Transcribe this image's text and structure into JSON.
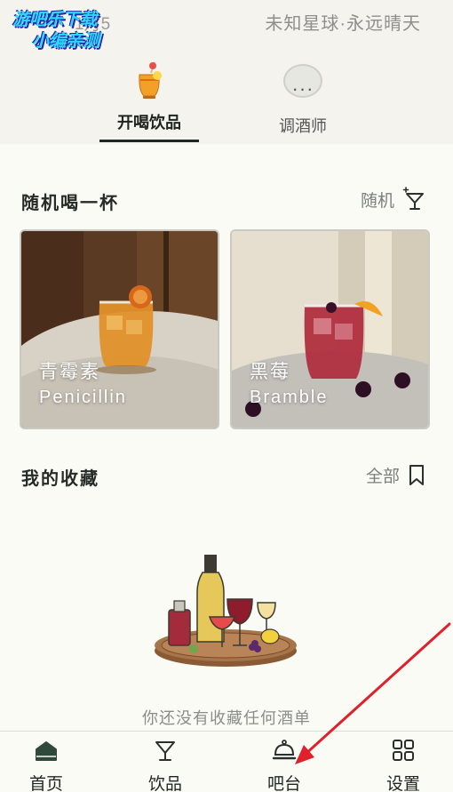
{
  "header": {
    "watermark_line1": "游吧乐下载",
    "watermark_line2": "小编亲测",
    "date_text": "1月5",
    "weather_text": "未知星球·永远晴天",
    "tabs": [
      {
        "label": "开喝饮品",
        "icon": "cocktail-emoji",
        "active": true
      },
      {
        "label": "调酒师",
        "icon": "speech-bubble-icon",
        "active": false
      }
    ]
  },
  "random_section": {
    "title": "随机喝一杯",
    "link_label": "随机",
    "link_icon": "cocktail-glass-sparkle-icon",
    "cards": [
      {
        "name_cn": "青霉素",
        "name_en": "Penicillin"
      },
      {
        "name_cn": "黑莓",
        "name_en": "Bramble"
      }
    ]
  },
  "favorites_section": {
    "title": "我的收藏",
    "link_label": "全部",
    "link_icon": "bookmark-icon",
    "empty_text": "你还没有收藏任何酒单"
  },
  "bottom_nav": {
    "items": [
      {
        "label": "首页",
        "icon": "home-icon",
        "active": true
      },
      {
        "label": "饮品",
        "icon": "cocktail-glass-icon",
        "active": false
      },
      {
        "label": "吧台",
        "icon": "service-bell-icon",
        "active": false
      },
      {
        "label": "设置",
        "icon": "grid-icon",
        "active": false
      }
    ]
  },
  "colors": {
    "background": "#fbfbf5",
    "header_bg": "#f4f3ee",
    "accent_dark": "#2f4a3a",
    "annotation_arrow": "#e0202a"
  }
}
